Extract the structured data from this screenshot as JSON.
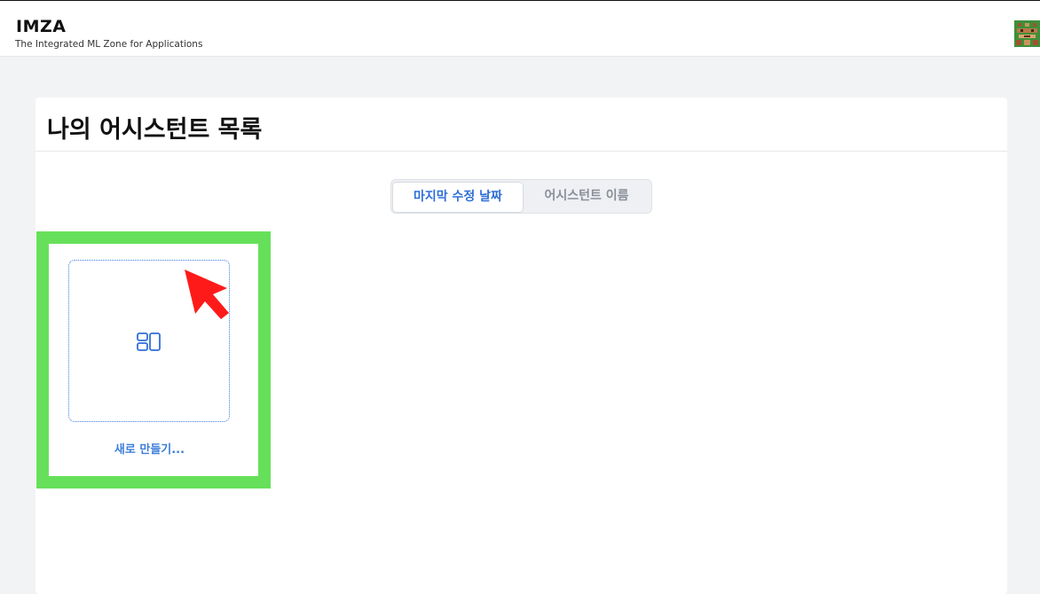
{
  "header": {
    "brand": "IMZA",
    "subtitle": "The Integrated ML Zone for Applications",
    "avatar_icon": "pixel-avatar-icon"
  },
  "main": {
    "title": "나의 어시스턴트 목록",
    "sort_tabs": [
      {
        "label": "마지막 수정 날짜",
        "active": true
      },
      {
        "label": "어시스턴트 이름",
        "active": false
      }
    ],
    "new_tile": {
      "icon": "layout-icon",
      "label": "새로 만들기..."
    }
  },
  "colors": {
    "accent": "#2f6fd6",
    "highlight": "#66e05a",
    "cursor": "#ff1a1a"
  }
}
